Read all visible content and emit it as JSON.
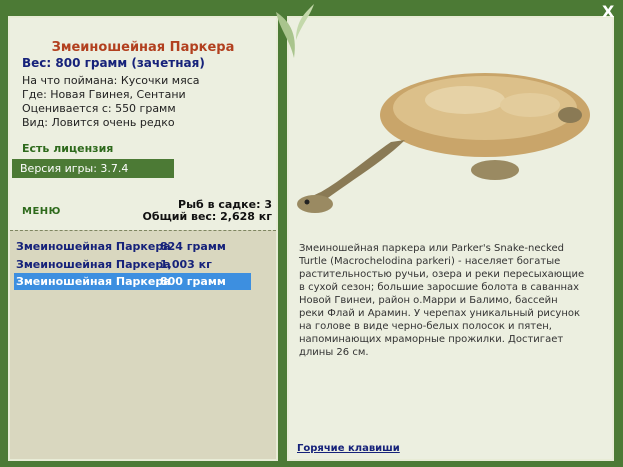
{
  "fish": {
    "title": "Змеиношейная Паркера",
    "weight": "Вес: 800 грамм (зачетная)",
    "bait": "На что поймана: Кусочки мяса",
    "place": "Где: Новая Гвинея, Сентани",
    "valued": "Оценивается с: 550 грамм",
    "catch": "Вид: Ловится очень редко"
  },
  "license": "Есть лицензия",
  "version": "Версия игры: 3.7.4",
  "menu_label": "МЕНЮ",
  "cage": {
    "count": "Рыб в садке: 3",
    "total": "Общий вес: 2,628 кг"
  },
  "catch_list": [
    {
      "name": "Змеиношейная Паркера",
      "weight": "824 грамм"
    },
    {
      "name": "Змеиношейная Паркера",
      "weight": "1,003 кг"
    },
    {
      "name": "Змеиношейная Паркера",
      "weight": "800 грамм"
    }
  ],
  "description": "Змеиношейная паркера или Parker's Snake-necked Turtle (Macrochelodina parkeri) - населяет богатые растительностью ручьи, озера и реки пересыхающие в сухой сезон; большие заросшие болота в саваннах Новой Гвинеи, район о.Марри и Балимо, бассейн реки Флай и Арамин. У черепах уникальный рисунок на голове в виде черно-белых полосок и пятен, напоминающих мраморные прожилки. Достигает длины 26 см.",
  "hotkeys": "Горячие клавиши",
  "close": "X",
  "colors": {
    "accent": "#4c7a35",
    "title": "#b2401f",
    "selected": "#3d8fe0"
  }
}
